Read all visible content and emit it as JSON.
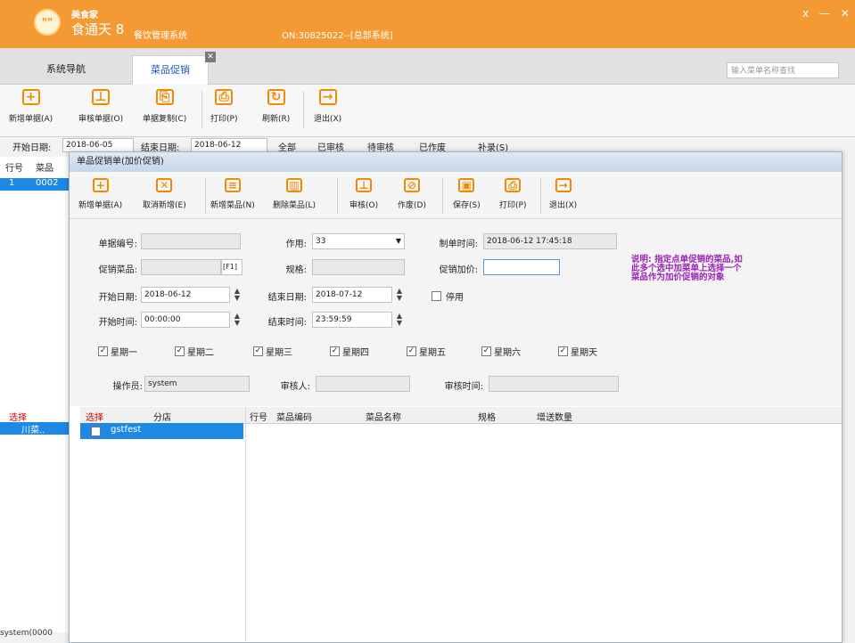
{
  "app": {
    "brand": "美食家",
    "product": "食通天 8",
    "system_name": "餐饮管理系统",
    "server_info": "ON:30825022--[总部系统]",
    "window_controls": "ⅹ — ✕",
    "logo_text": "\"\""
  },
  "tabs": [
    {
      "label": "系统导航"
    },
    {
      "label": "菜品促销"
    }
  ],
  "tab_close": "✕",
  "search": {
    "placeholder": "输入菜单名称查找"
  },
  "toolbar": [
    {
      "label": "新增单据(A)",
      "icon": "plus-icon",
      "glyph": "+"
    },
    {
      "label": "审核单据(O)",
      "icon": "stamp-icon",
      "glyph": "⊥"
    },
    {
      "label": "单据复制(C)",
      "icon": "copy-icon",
      "glyph": "⎘"
    },
    {
      "label": "打印(P)",
      "icon": "printer-icon",
      "glyph": "⎙"
    },
    {
      "label": "刷新(R)",
      "icon": "refresh-icon",
      "glyph": "↻"
    },
    {
      "label": "退出(X)",
      "icon": "exit-icon",
      "glyph": "→"
    }
  ],
  "filter": {
    "start_label": "开始日期:",
    "start_value": "2018-06-05",
    "end_label": "结束日期:",
    "end_value": "2018-06-12",
    "options": [
      "全部",
      "已审核",
      "待审核",
      "已作废"
    ],
    "extra": "补录(S)"
  },
  "background_grid": {
    "headers": [
      "行号",
      "菜品"
    ],
    "row_cells": [
      "1",
      "0002"
    ],
    "lower_header": "选择",
    "lower_row": "川菜..",
    "status": "system(0000"
  },
  "dialog": {
    "title": "单品促销单(加价促销)",
    "toolbar": [
      {
        "label": "新增单据(A)",
        "icon": "plus-icon",
        "glyph": "+"
      },
      {
        "label": "取消新增(E)",
        "icon": "cancel-doc-icon",
        "glyph": "✕"
      },
      {
        "label": "新增菜品(N)",
        "icon": "add-dish-icon",
        "glyph": "≡"
      },
      {
        "label": "删除菜品(L)",
        "icon": "trash-icon",
        "glyph": "▥"
      },
      {
        "label": "审核(O)",
        "icon": "stamp-icon",
        "glyph": "⊥"
      },
      {
        "label": "作废(D)",
        "icon": "void-icon",
        "glyph": "⊘"
      },
      {
        "label": "保存(S)",
        "icon": "save-icon",
        "glyph": "▣"
      },
      {
        "label": "打印(P)",
        "icon": "printer-icon",
        "glyph": "⎙"
      },
      {
        "label": "退出(X)",
        "icon": "exit-icon",
        "glyph": "→"
      }
    ],
    "form": {
      "doc_no_label": "单据编号:",
      "doc_no_value": "",
      "method_label": "作用:",
      "method_value": "33",
      "created_label": "制单时间:",
      "created_value": "2018-06-12 17:45:18",
      "dish_label": "促销菜品:",
      "dish_value": "",
      "dish_btn": "[F1]",
      "spec_label": "规格:",
      "spec_value": "",
      "price_label": "促销加价:",
      "price_value": "",
      "start_date_label": "开始日期:",
      "start_date_value": "2018-06-12",
      "end_date_label": "结束日期:",
      "end_date_value": "2018-07-12",
      "disabled_label": "停用",
      "start_time_label": "开始时间:",
      "start_time_value": "00:00:00",
      "end_time_label": "结束时间:",
      "end_time_value": "23:59:59",
      "weekdays": [
        "星期一",
        "星期二",
        "星期三",
        "星期四",
        "星期五",
        "星期六",
        "星期天"
      ],
      "operator_label": "操作员:",
      "operator_value": "system",
      "reviewer_label": "审核人:",
      "reviewer_value": "",
      "review_time_label": "审核时间:",
      "review_time_value": ""
    },
    "note": "说明: 指定点单促销的菜品,如此多个选中加菜单上选择一个菜品作为加价促销的对象",
    "left_grid": {
      "headers": [
        "选择",
        "分店"
      ],
      "row": "gstfest"
    },
    "right_grid": {
      "headers": [
        "行号",
        "菜品编码",
        "菜品名称",
        "规格",
        "增送数量"
      ]
    }
  },
  "colors": {
    "titlebar": "#f49a35",
    "accent": "#f08a00",
    "selection": "#1e88e5",
    "note": "#9b23b5"
  }
}
